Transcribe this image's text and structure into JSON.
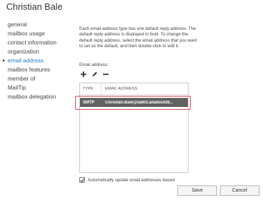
{
  "header": {
    "title": "Christian Bale"
  },
  "sidebar": {
    "items": [
      {
        "label": "general"
      },
      {
        "label": "mailbox usage"
      },
      {
        "label": "contact information"
      },
      {
        "label": "organization"
      },
      {
        "label": "email address",
        "active": true
      },
      {
        "label": "mailbox features"
      },
      {
        "label": "member of"
      },
      {
        "label": "MailTip"
      },
      {
        "label": "mailbox delegation"
      }
    ]
  },
  "main": {
    "description": "Each email address type has one default reply address. The default reply address is displayed in bold. To change the default reply address, select the email address that you want to set as the default, and then double-click to edit it.",
    "email_label": "Email address:",
    "toolbar": {
      "add_icon": "plus-icon",
      "edit_icon": "pencil-icon",
      "remove_icon": "minus-icon"
    },
    "grid": {
      "columns": [
        "TYPE",
        "EMAIL ADDRESS"
      ],
      "rows": [
        {
          "type": "SMTP",
          "address": "Christian.Bale@lab03.allabout36..."
        }
      ]
    },
    "auto_update_label": "Automatically update email addresses based",
    "auto_update_checked": true
  },
  "footer": {
    "save_label": "Save",
    "cancel_label": "Cancel"
  },
  "colors": {
    "accent": "#1f7cc1",
    "selected_row": "#616161",
    "highlight_border": "#d9404f"
  }
}
